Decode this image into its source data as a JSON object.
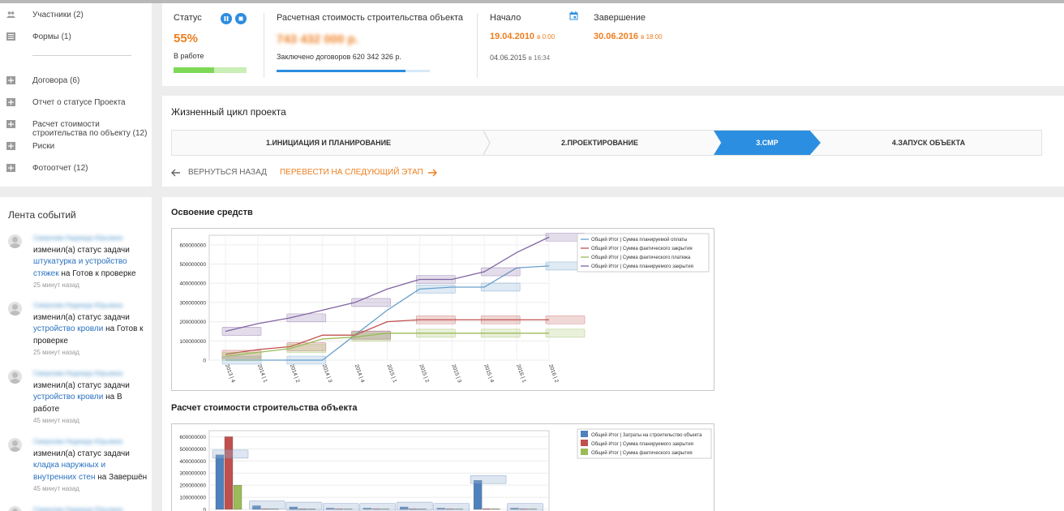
{
  "nav": {
    "items": [
      {
        "label": "Участники (2)",
        "icon": "people-icon"
      },
      {
        "label": "Формы (1)",
        "icon": "form-icon"
      },
      {
        "label": "Договора (6)",
        "icon": "plus-box-icon"
      },
      {
        "label": "Отчет о статусе Проекта",
        "icon": "plus-box-icon"
      },
      {
        "label": "Расчет стоимости строительства по объекту (12)",
        "icon": "plus-box-icon"
      },
      {
        "label": "Риски",
        "icon": "plus-box-icon"
      },
      {
        "label": "Фотоотчет (12)",
        "icon": "plus-box-icon"
      }
    ]
  },
  "feed": {
    "title": "Лента событий",
    "user_name": "Смирнова Надежда Юрьевна",
    "action_text": "изменил(а) статус задачи",
    "status_prefix": "на",
    "items": [
      {
        "task": "штукатурка и устройство стяжек",
        "status": "Готов к проверке",
        "time": "25 минут назад"
      },
      {
        "task": "устройство кровли",
        "status": "Готов к проверке",
        "time": "25 минут назад"
      },
      {
        "task": "устройство кровли",
        "status": "В работе",
        "time": "45 минут назад"
      },
      {
        "task": "кладка наружных и внутренних стен",
        "status": "Завершён",
        "time": "45 минут назад"
      }
    ]
  },
  "header": {
    "status_label": "Статус",
    "status_percent": "55%",
    "status_text": "В работе",
    "status_progress": 0.55,
    "cost_label": "Расчетная стоимость строительства объекта",
    "cost_value": "743 432 000 р.",
    "contracts_text": "Заключено договоров 620 342 326 р.",
    "contracts_progress": 0.84,
    "start_label": "Начало",
    "start_date": "19.04.2010",
    "start_time": "в 0:00",
    "start_sub_date": "04.06.2015",
    "start_sub_time": "в 16:34",
    "end_label": "Завершение",
    "end_date": "30.06.2016",
    "end_time": "в 18:00"
  },
  "lifecycle": {
    "title": "Жизненный цикл проекта",
    "stages": [
      "1.ИНИЦИАЦИЯ И ПЛАНИРОВАНИЕ",
      "2.ПРОЕКТИРОВАНИЕ",
      "3.СМР",
      "4.ЗАПУСК ОБЪЕКТА"
    ],
    "active_stage": 2,
    "back_label": "ВЕРНУТЬСЯ НАЗАД",
    "next_label": "ПЕРЕВЕСТИ НА СЛЕДУЮЩИЙ ЭТАП"
  },
  "colors": {
    "accent": "#2b8ee0",
    "orange": "#ee7e1f",
    "green": "#7ed957",
    "series_blue": "#6a9fcb",
    "series_red": "#c0504d",
    "series_green": "#9bbb59",
    "series_purple": "#8064a2"
  },
  "chart_data": [
    {
      "type": "line",
      "title": "Освоение средств",
      "categories": [
        "2013 | 4",
        "2014 | 1",
        "2014 | 2",
        "2014 | 3",
        "2014 | 4",
        "2015 | 1",
        "2015 | 2",
        "2015 | 3",
        "2015 | 4",
        "2016 | 1",
        "2016 | 2"
      ],
      "ylim": [
        0,
        650000000
      ],
      "yticks": [
        "0",
        "100000000",
        "200000000",
        "300000000",
        "400000000",
        "500000000",
        "600000000"
      ],
      "legend_position": "top-right",
      "series": [
        {
          "name": "Общий Итог | Сумма планируемой оплаты",
          "color": "#6a9fcb",
          "values": [
            0,
            0,
            0,
            0,
            130000000,
            260000000,
            370000000,
            380000000,
            380000000,
            480000000,
            490000000
          ]
        },
        {
          "name": "Общий Итог | Сумма фактического закрытия",
          "color": "#c0504d",
          "values": [
            30000000,
            55000000,
            70000000,
            130000000,
            130000000,
            200000000,
            210000000,
            210000000,
            210000000,
            210000000,
            210000000
          ]
        },
        {
          "name": "Общий Итог | Сумма фактического платежа",
          "color": "#9bbb59",
          "values": [
            20000000,
            40000000,
            60000000,
            110000000,
            120000000,
            140000000,
            140000000,
            140000000,
            140000000,
            140000000,
            140000000
          ]
        },
        {
          "name": "Общий Итог | Сумма планируемого закрытия",
          "color": "#8064a2",
          "values": [
            150000000,
            190000000,
            220000000,
            260000000,
            300000000,
            370000000,
            420000000,
            420000000,
            460000000,
            560000000,
            640000000
          ]
        }
      ]
    },
    {
      "type": "bar",
      "title": "Расчет стоимости строительства объекта",
      "yticks": [
        "0",
        "100000000",
        "200000000",
        "300000000",
        "400000000",
        "500000000",
        "600000000"
      ],
      "ylim": [
        0,
        650000000
      ],
      "legend_position": "top-right",
      "series": [
        {
          "name": "Общий Итог | Затраты на строительство объекта",
          "color": "#4f81bd",
          "values": [
            450000000,
            30000000,
            20000000,
            10000000,
            10000000,
            20000000,
            10000000,
            240000000,
            10000000
          ]
        },
        {
          "name": "Общий Итог | Сумма планируемого закрытия",
          "color": "#c0504d",
          "values": [
            600000000,
            5000000,
            5000000,
            5000000,
            5000000,
            5000000,
            5000000,
            5000000,
            5000000
          ]
        },
        {
          "name": "Общий Итог | Сумма фактического закрытия",
          "color": "#9bbb59",
          "values": [
            200000000,
            5000000,
            5000000,
            5000000,
            5000000,
            5000000,
            5000000,
            5000000,
            5000000
          ]
        }
      ]
    }
  ]
}
